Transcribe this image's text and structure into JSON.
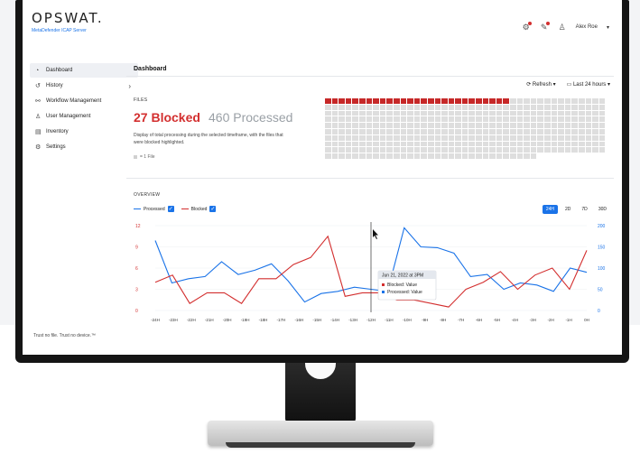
{
  "header": {
    "logo": "OPSWAT.",
    "product": "MetaDefender ICAP Server",
    "user": "Alex Roe",
    "user_menu_caret": "▾"
  },
  "sidebar": {
    "items": [
      {
        "label": "Dashboard",
        "icon": "gauge-icon"
      },
      {
        "label": "History",
        "icon": "history-icon"
      },
      {
        "label": "Workflow Management",
        "icon": "workflow-icon"
      },
      {
        "label": "User Management",
        "icon": "users-icon"
      },
      {
        "label": "Inventory",
        "icon": "inventory-icon"
      },
      {
        "label": "Settings",
        "icon": "gear-icon"
      }
    ],
    "footer": "Trust no file. Trust no device.™"
  },
  "main": {
    "title": "Dashboard",
    "refresh": "Refresh",
    "range": "Last 24 hours",
    "files_label": "FILES",
    "blocked": "27 Blocked",
    "processed": "460 Processed",
    "description": "Display of total processing during the selected timeframe, with the files that were blocked highlighted.",
    "legend_file": "= 1 File",
    "overview_label": "OVERVIEW",
    "series_processed": "Processed",
    "series_blocked": "Blocked",
    "time_filters": [
      "24H",
      "2D",
      "7D",
      "30D"
    ],
    "active_filter": "24H"
  },
  "file_grid": {
    "blocked": 27,
    "total": 460
  },
  "colors": {
    "blocked": "#d32f2f",
    "processed": "#1a73e8",
    "accent": "#1a73e8"
  },
  "chart_data": {
    "type": "line",
    "x": [
      "-24H",
      "-23H",
      "-22H",
      "-21H",
      "-20H",
      "-19H",
      "-18H",
      "-17H",
      "-16H",
      "-15H",
      "-14H",
      "-13H",
      "-12H",
      "-11H",
      "-10H",
      "-9H",
      "-8H",
      "-7H",
      "-6H",
      "-5H",
      "-4H",
      "-3H",
      "-2H",
      "-1H",
      "0H"
    ],
    "left_axis": {
      "ticks": [
        "12",
        "9",
        "6",
        "3",
        "0"
      ],
      "ylim": [
        0,
        12
      ]
    },
    "right_axis": {
      "ticks": [
        "200",
        "150",
        "100",
        "50",
        "0"
      ],
      "ylim": [
        0,
        200
      ]
    },
    "series": [
      {
        "name": "Processed",
        "axis": "right",
        "color": "#1a73e8",
        "values": [
          165,
          65,
          75,
          80,
          115,
          85,
          95,
          110,
          70,
          20,
          40,
          45,
          55,
          50,
          45,
          195,
          150,
          148,
          135,
          80,
          85,
          50,
          65,
          60,
          45,
          100,
          90
        ]
      },
      {
        "name": "Blocked",
        "axis": "left",
        "color": "#d32f2f",
        "values": [
          4,
          5,
          1,
          2.5,
          2.5,
          1,
          4.5,
          4.5,
          6.5,
          7.5,
          10.5,
          2,
          2.5,
          2.5,
          1.5,
          1.5,
          1,
          0.5,
          3,
          4,
          5.5,
          3,
          5,
          6,
          3,
          8.5
        ]
      }
    ],
    "tooltip": {
      "date": "Jun 21, 2022 at 3PM",
      "blocked": "Blocked: Value",
      "processed": "Processed: Value"
    }
  }
}
